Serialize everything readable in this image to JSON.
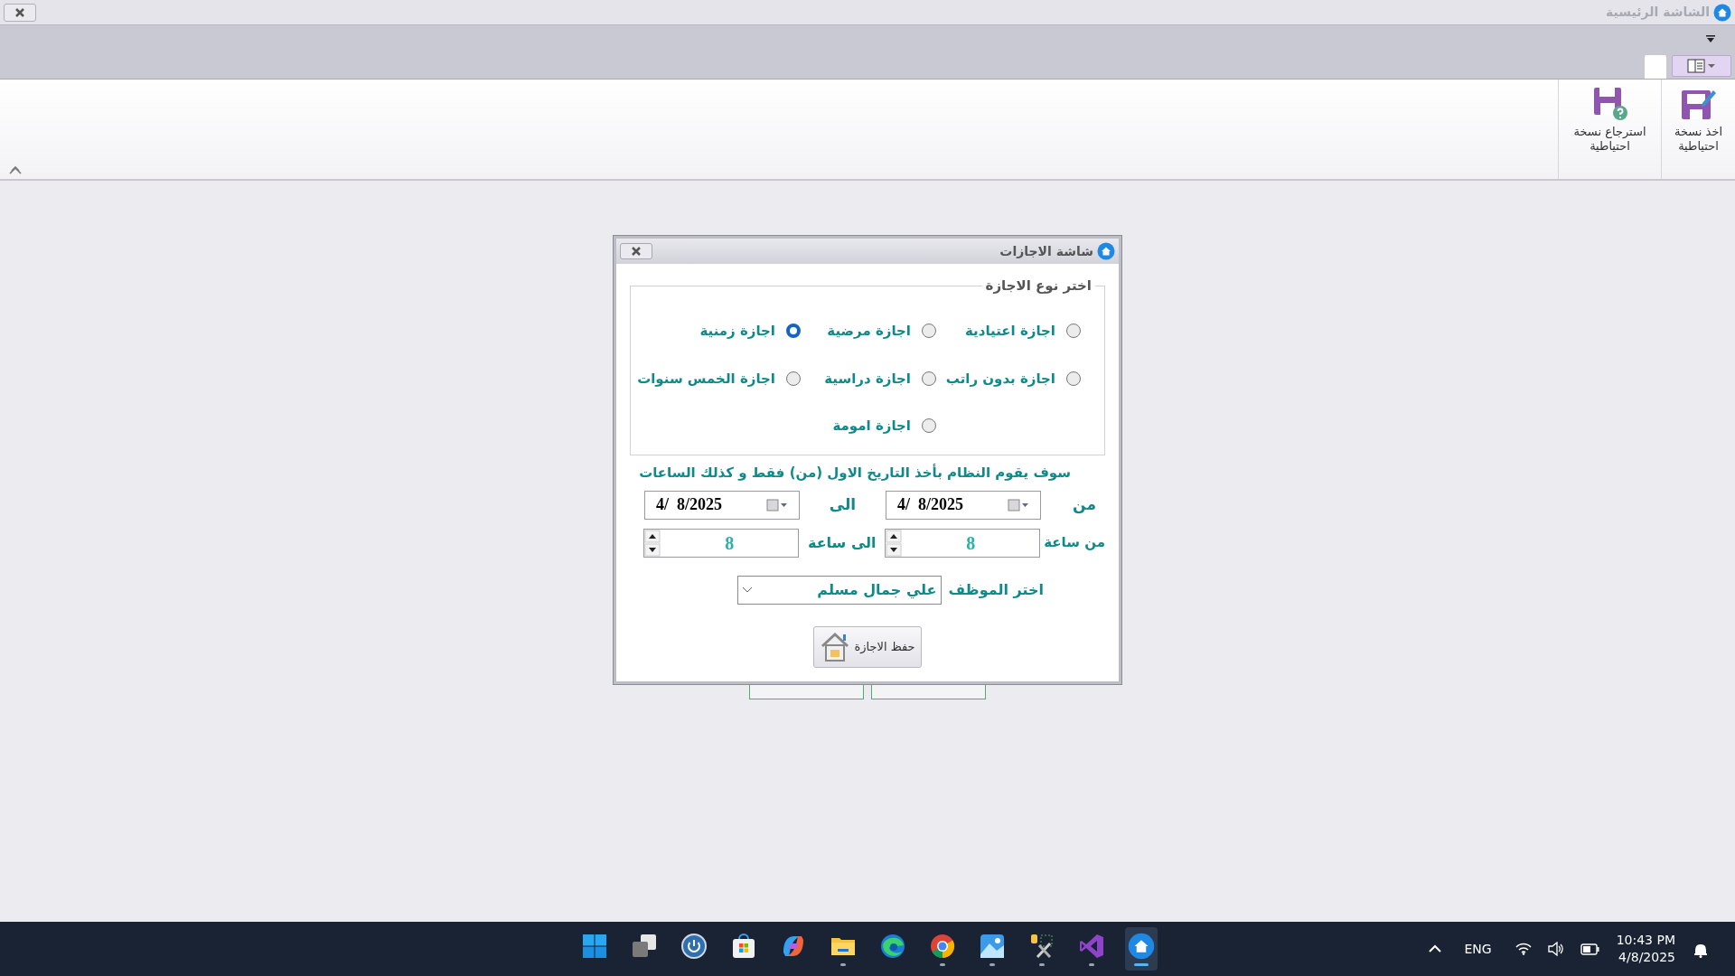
{
  "main_window": {
    "title": "الشاشة الرئيسية"
  },
  "ribbon": {
    "buttons": [
      {
        "label": "اخذ نسخة احتياطية",
        "kind": "backup"
      },
      {
        "label": "استرجاع نسخة احتياطية",
        "kind": "restore"
      }
    ]
  },
  "dialog": {
    "title": "شاشة الاجازات",
    "group_title": "اختر نوع الاجازة",
    "leave_types": [
      {
        "label": "اجازة اعتيادية",
        "selected": false
      },
      {
        "label": "اجازة مرضية",
        "selected": false
      },
      {
        "label": "اجازة زمنية",
        "selected": true
      },
      {
        "label": "اجازة بدون راتب",
        "selected": false
      },
      {
        "label": "اجازة دراسية",
        "selected": false
      },
      {
        "label": "اجازة الخمس سنوات",
        "selected": false
      },
      {
        "label": "اجازة امومة",
        "selected": false
      }
    ],
    "note": "سوف يقوم النظام بأخذ التاريخ الاول (من) فقط و كذلك الساعات",
    "from_label": "من",
    "from_date": "4/  8/2025",
    "to_label": "الى",
    "to_date": "4/  8/2025",
    "from_hour_label": "من ساعة",
    "from_hour": "8",
    "to_hour_label": "الى ساعة",
    "to_hour": "8",
    "employee_label": "اختر الموظف",
    "employee": "علي جمال مسلم",
    "save_button": "حفظ الاجازة"
  },
  "taskbar": {
    "apps": [
      {
        "kind": "start",
        "running": false,
        "selected": false
      },
      {
        "kind": "taskview",
        "running": false,
        "selected": false
      },
      {
        "kind": "power",
        "running": false,
        "selected": false
      },
      {
        "kind": "store",
        "running": false,
        "selected": false
      },
      {
        "kind": "copilot",
        "running": false,
        "selected": false
      },
      {
        "kind": "folder",
        "running": true,
        "selected": false
      },
      {
        "kind": "edge",
        "running": false,
        "selected": false
      },
      {
        "kind": "chrome",
        "running": true,
        "selected": false
      },
      {
        "kind": "photos",
        "running": true,
        "selected": false
      },
      {
        "kind": "tools",
        "running": true,
        "selected": false
      },
      {
        "kind": "vs",
        "running": true,
        "selected": false
      },
      {
        "kind": "home",
        "running": true,
        "selected": true
      }
    ],
    "language": "ENG",
    "time": "10:43 PM",
    "date": "4/8/2025"
  }
}
